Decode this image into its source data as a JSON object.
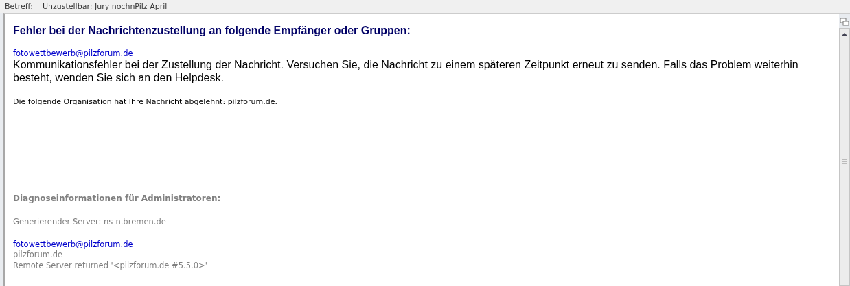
{
  "header": {
    "label": "Betreff:",
    "subject": "Unzustellbar: Jury nochnPilz April"
  },
  "message": {
    "heading": "Fehler bei der Nachrichtenzustellung an folgende Empfänger oder Gruppen:",
    "recipient_link": "fotowettbewerb@pilzforum.de",
    "error_text": "Kommunikationsfehler bei der Zustellung der Nachricht. Versuchen Sie, die Nachricht zu einem späteren Zeitpunkt erneut zu senden. Falls das Problem weiterhin besteht, wenden Sie sich an den Helpdesk.",
    "organisation_note": "Die folgende Organisation hat Ihre Nachricht abgelehnt: pilzforum.de."
  },
  "diagnostics": {
    "heading": "Diagnoseinformationen für Administratoren:",
    "server": "Generierender Server: ns-n.bremen.de",
    "recipient_link": "fotowettbewerb@pilzforum.de",
    "lines": [
      "pilzforum.de",
      "Remote Server returned '<pilzforum.de #5.5.0>'"
    ]
  }
}
